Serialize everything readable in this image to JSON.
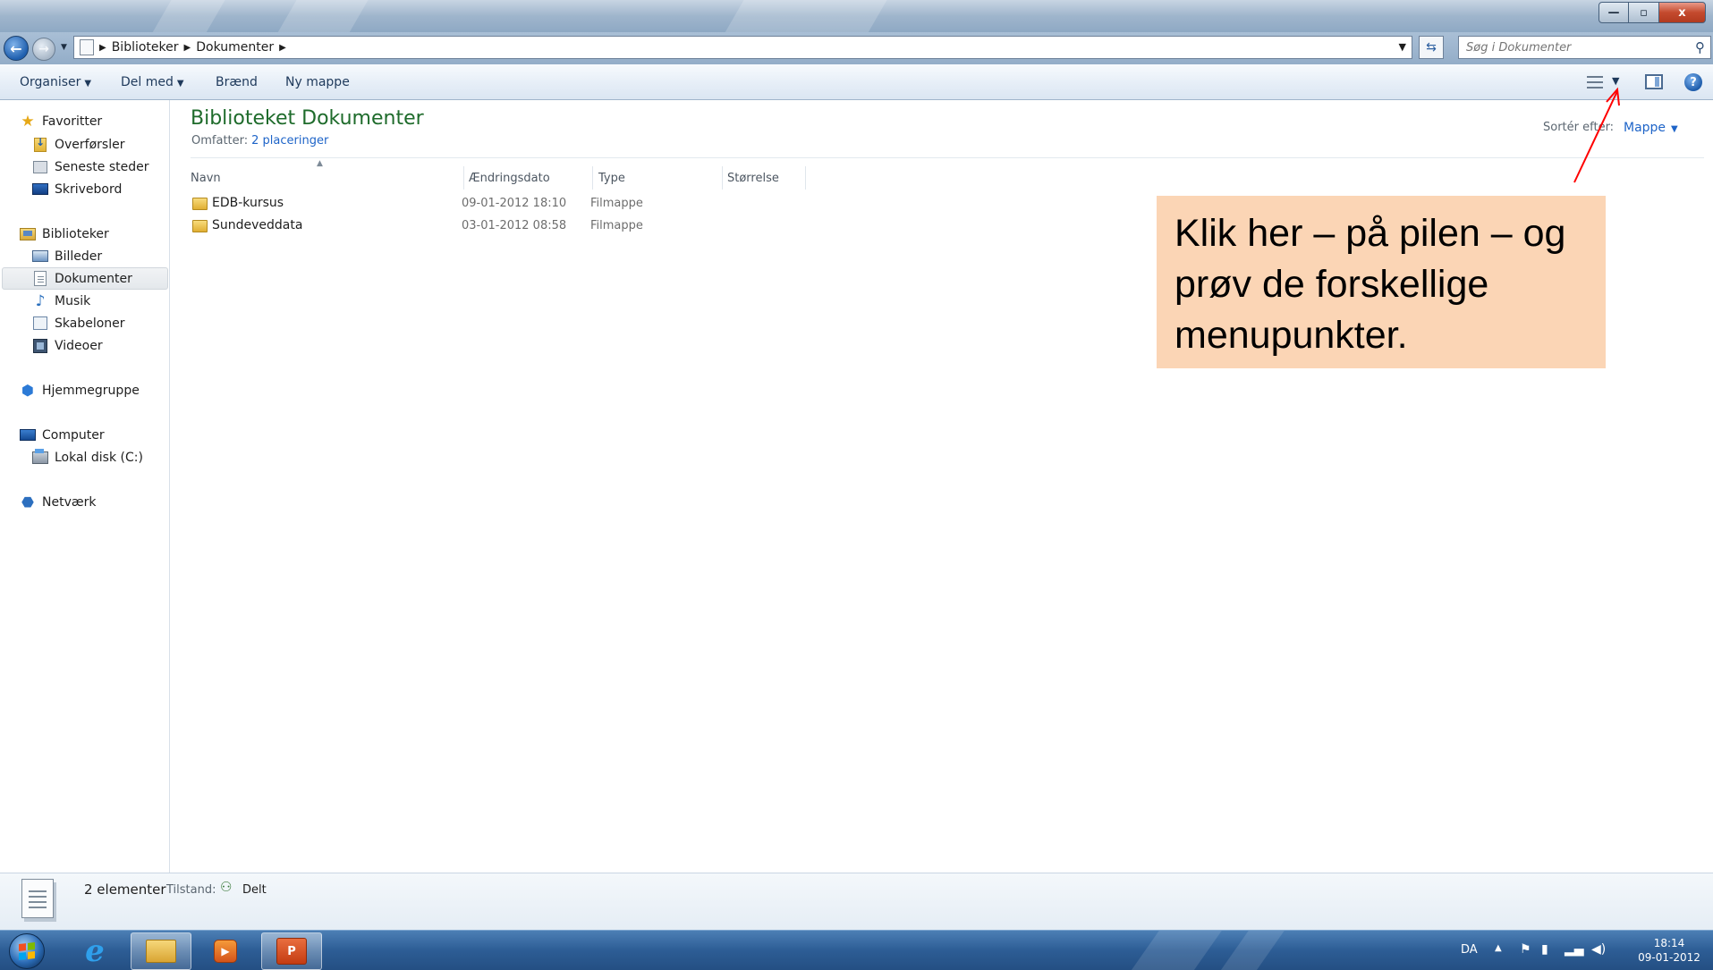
{
  "window": {
    "caption_minimize": "—",
    "caption_maximize": "▫",
    "caption_close": "x"
  },
  "address": {
    "crumbs": [
      "Biblioteker",
      "Dokumenter"
    ],
    "search_placeholder": "Søg i Dokumenter"
  },
  "toolbar": {
    "organize": "Organiser",
    "share_with": "Del med",
    "burn": "Brænd",
    "new_folder": "Ny mappe"
  },
  "navigation": {
    "favorites": {
      "label": "Favoritter",
      "items": [
        "Overførsler",
        "Seneste steder",
        "Skrivebord"
      ]
    },
    "libraries": {
      "label": "Biblioteker",
      "items": [
        "Billeder",
        "Dokumenter",
        "Musik",
        "Skabeloner",
        "Videoer"
      ],
      "selected": "Dokumenter"
    },
    "homegroup": "Hjemmegruppe",
    "computer": {
      "label": "Computer",
      "items": [
        "Lokal disk (C:)"
      ]
    },
    "network": "Netværk"
  },
  "library": {
    "title": "Biblioteket Dokumenter",
    "includes_label": "Omfatter:",
    "includes_link": "2 placeringer",
    "sort_label": "Sortér efter:",
    "sort_value": "Mappe"
  },
  "columns": [
    "Navn",
    "Ændringsdato",
    "Type",
    "Størrelse"
  ],
  "files": [
    {
      "name": "EDB-kursus",
      "modified": "09-01-2012 18:10",
      "type": "Filmappe"
    },
    {
      "name": "Sundeveddata",
      "modified": "03-01-2012 08:58",
      "type": "Filmappe"
    }
  ],
  "callout": {
    "text": "Klik her – på pilen – og prøv de forskellige menupunkter.",
    "background": "#FBD5B5",
    "arrow_color": "#FF0000"
  },
  "details": {
    "count": "2 elementer",
    "state_label": "Tilstand:",
    "state_value": "Delt"
  },
  "taskbar": {
    "ppt_label": "P",
    "tray": {
      "language": "DA",
      "time": "18:14",
      "date": "09-01-2012"
    }
  }
}
